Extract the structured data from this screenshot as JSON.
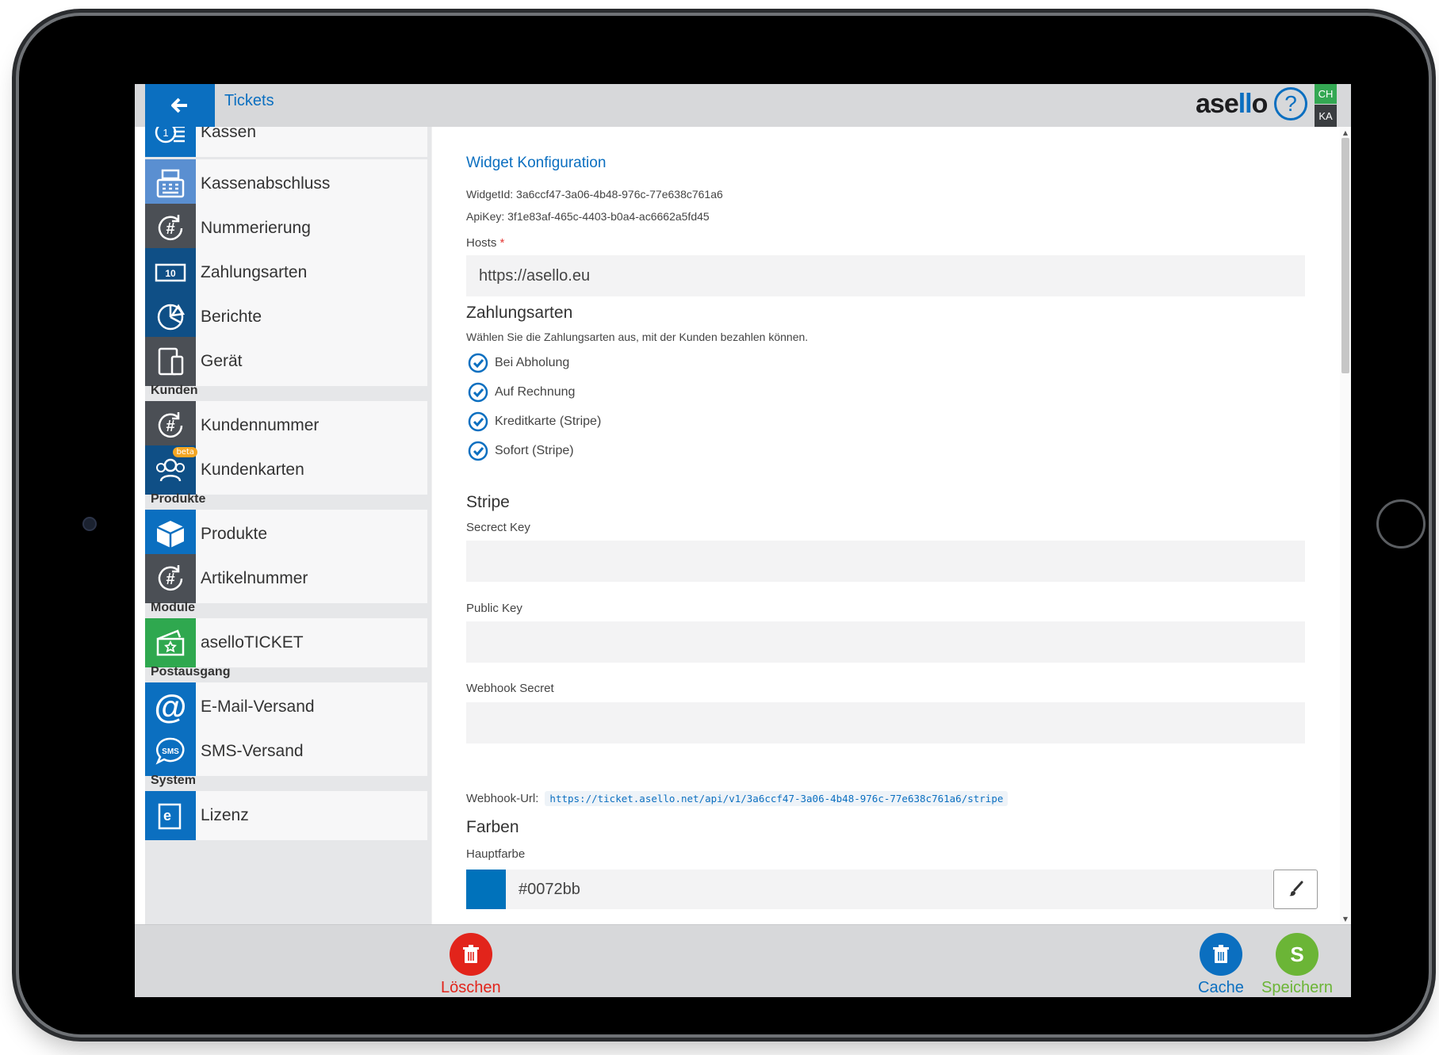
{
  "header": {
    "title": "Tickets",
    "logo_text": "asello",
    "badge_top": "CH",
    "badge_bottom": "KA"
  },
  "sidebar": {
    "items": [
      {
        "label": "Kassen",
        "icon": "coins-icon"
      },
      {
        "label": "Kassenabschluss",
        "icon": "cash-register-icon"
      },
      {
        "label": "Nummerierung",
        "icon": "hash-refresh-icon"
      },
      {
        "label": "Zahlungsarten",
        "icon": "banknote-icon"
      },
      {
        "label": "Berichte",
        "icon": "pie-chart-icon"
      },
      {
        "label": "Gerät",
        "icon": "devices-icon"
      },
      {
        "label": "Kundennummer",
        "icon": "hash-refresh-icon"
      },
      {
        "label": "Kundenkarten",
        "icon": "users-icon",
        "badge": "beta"
      },
      {
        "label": "Produkte",
        "icon": "box-icon"
      },
      {
        "label": "Artikelnummer",
        "icon": "hash-refresh-icon"
      },
      {
        "label": "aselloTICKET",
        "icon": "ticket-icon"
      },
      {
        "label": "E-Mail-Versand",
        "icon": "at-icon"
      },
      {
        "label": "SMS-Versand",
        "icon": "sms-icon"
      },
      {
        "label": "Lizenz",
        "icon": "license-icon"
      }
    ],
    "sections": [
      "Kunden",
      "Produkte",
      "Module",
      "Postausgang",
      "System"
    ]
  },
  "main": {
    "title": "Widget Konfiguration",
    "widget_id": "WidgetId: 3a6ccf47-3a06-4b48-976c-77e638c761a6",
    "api_key": "ApiKey: 3f1e83af-465c-4403-b0a4-ac6662a5fd45",
    "hosts_label": "Hosts",
    "hosts_required": "*",
    "hosts_value": "https://asello.eu",
    "zahlungsarten_title": "Zahlungsarten",
    "zahlungsarten_desc": "Wählen Sie die Zahlungsarten aus, mit der Kunden bezahlen können.",
    "payment_options": [
      "Bei Abholung",
      "Auf Rechnung",
      "Kreditkarte (Stripe)",
      "Sofort (Stripe)"
    ],
    "stripe_title": "Stripe",
    "secret_key_label": "Secrect Key",
    "secret_key_value": "",
    "public_key_label": "Public Key",
    "public_key_value": "",
    "webhook_secret_label": "Webhook Secret",
    "webhook_secret_value": "",
    "webhook_url_label": "Webhook-Url:",
    "webhook_url_value": "https://ticket.asello.net/api/v1/3a6ccf47-3a06-4b48-976c-77e638c761a6/stripe",
    "farben_title": "Farben",
    "hauptfarbe_label": "Hauptfarbe",
    "hauptfarbe_value": "#0072bb"
  },
  "footer": {
    "delete_label": "Löschen",
    "cache_label": "Cache",
    "save_label": "Speichern",
    "save_letter": "S"
  },
  "colors": {
    "accent": "#0b6fc0",
    "delete": "#e2241b",
    "save": "#6bb536",
    "main_color": "#0072bb"
  }
}
